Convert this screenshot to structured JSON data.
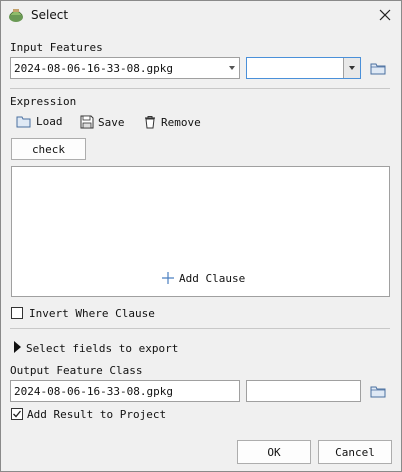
{
  "window": {
    "title": "Select"
  },
  "input_features": {
    "label": "Input Features",
    "value": "2024-08-06-16-33-08.gpkg",
    "second_value": ""
  },
  "expression": {
    "label": "Expression",
    "load_label": "Load",
    "save_label": "Save",
    "remove_label": "Remove",
    "check_label": "check",
    "add_clause_label": "Add Clause"
  },
  "invert_where": {
    "label": "Invert Where Clause",
    "checked": false
  },
  "select_fields": {
    "label": "Select fields to export"
  },
  "output": {
    "label": "Output Feature Class",
    "value": "2024-08-06-16-33-08.gpkg",
    "second_value": ""
  },
  "add_result": {
    "label": "Add Result to Project",
    "checked": true
  },
  "buttons": {
    "ok": "OK",
    "cancel": "Cancel"
  },
  "colors": {
    "folder": "#e9c46a",
    "accent": "#4a90d9"
  }
}
